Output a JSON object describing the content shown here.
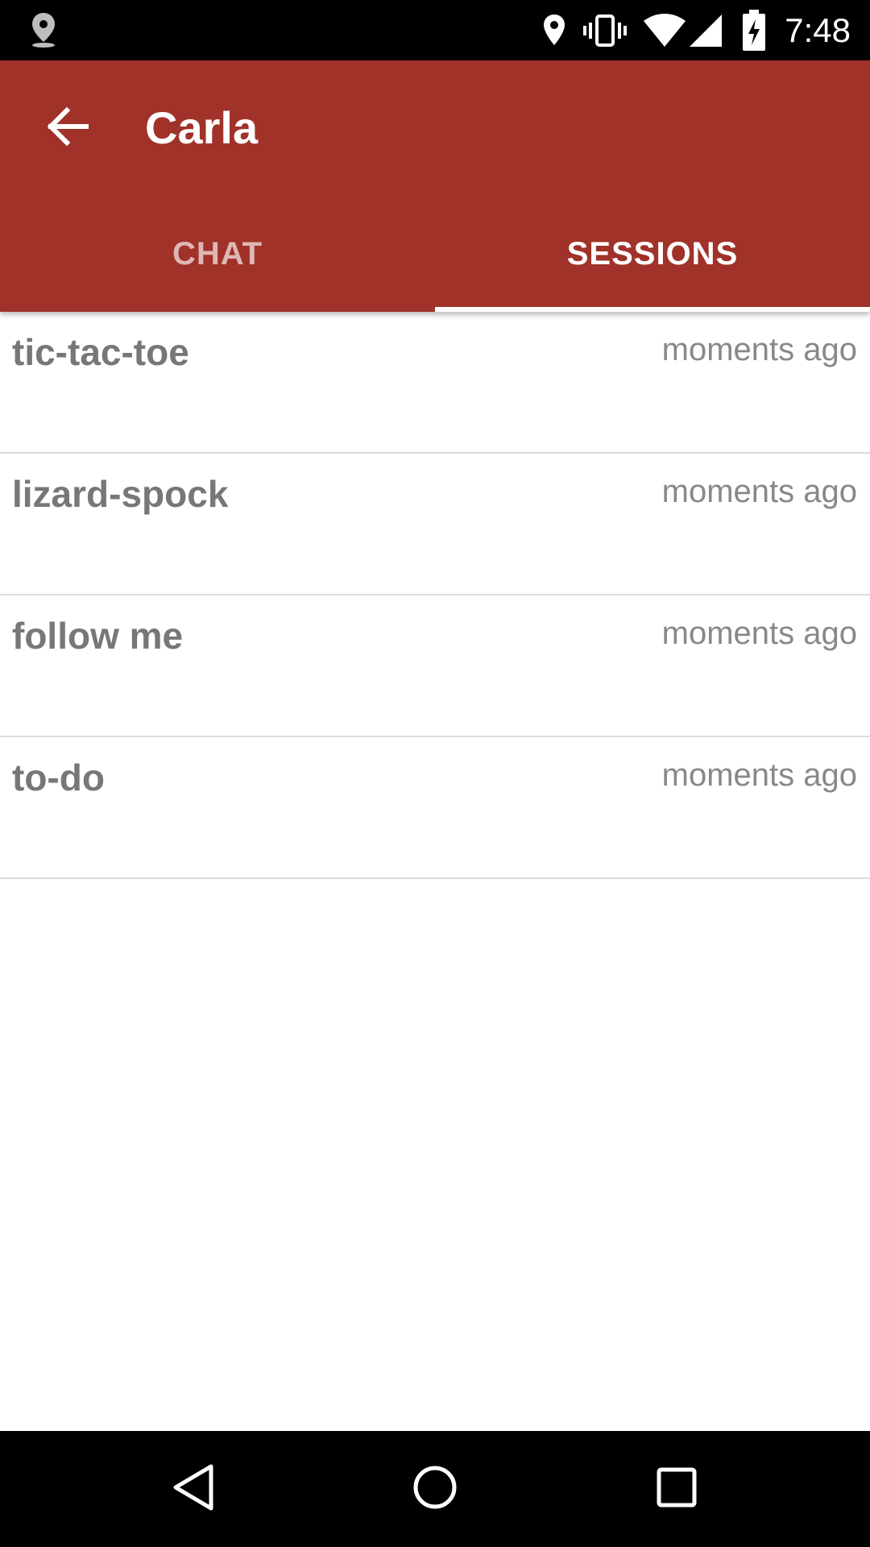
{
  "status_bar": {
    "time": "7:48",
    "left_icons": [
      "location-marker-icon"
    ],
    "right_icons": [
      "location-pin-icon",
      "vibrate-icon",
      "wifi-icon",
      "cell-signal-icon",
      "battery-charging-icon"
    ]
  },
  "app_bar": {
    "title": "Carla",
    "back_icon": "arrow-left-icon",
    "color": "#a0322a"
  },
  "tabs": [
    {
      "label": "CHAT",
      "active": false
    },
    {
      "label": "SESSIONS",
      "active": true
    }
  ],
  "sessions": [
    {
      "name": "tic-tac-toe",
      "time": "moments ago"
    },
    {
      "name": "lizard-spock",
      "time": "moments ago"
    },
    {
      "name": "follow me",
      "time": "moments ago"
    },
    {
      "name": "to-do",
      "time": "moments ago"
    }
  ],
  "nav_bar": {
    "buttons": [
      "back-triangle-icon",
      "home-circle-icon",
      "recents-square-icon"
    ]
  }
}
